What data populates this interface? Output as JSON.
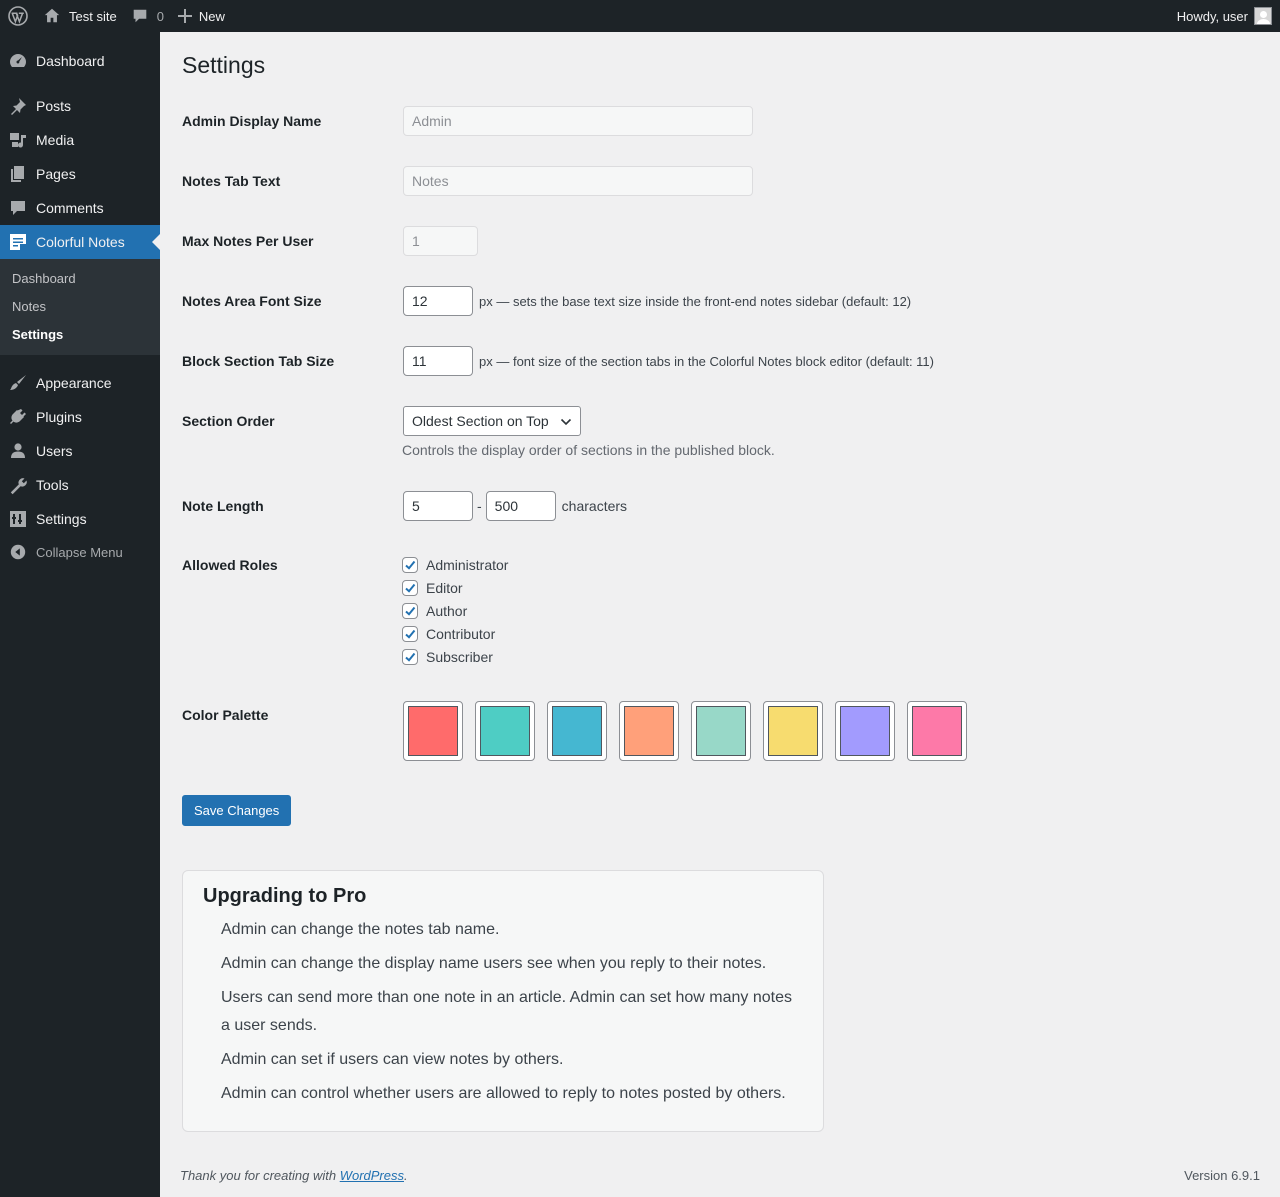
{
  "admin_bar": {
    "site_name": "Test site",
    "comments_count": "0",
    "new_label": "New",
    "greeting": "Howdy, user"
  },
  "sidebar": {
    "items": [
      {
        "label": "Dashboard",
        "icon": "dashboard-icon"
      },
      {
        "label": "Posts",
        "icon": "pin-icon"
      },
      {
        "label": "Media",
        "icon": "media-icon"
      },
      {
        "label": "Pages",
        "icon": "pages-icon"
      },
      {
        "label": "Comments",
        "icon": "comment-icon"
      },
      {
        "label": "Colorful Notes",
        "icon": "notes-icon",
        "current": true
      },
      {
        "label": "Appearance",
        "icon": "brush-icon"
      },
      {
        "label": "Plugins",
        "icon": "plugin-icon"
      },
      {
        "label": "Users",
        "icon": "user-icon"
      },
      {
        "label": "Tools",
        "icon": "wrench-icon"
      },
      {
        "label": "Settings",
        "icon": "settings-icon"
      }
    ],
    "submenu": [
      {
        "label": "Dashboard"
      },
      {
        "label": "Notes"
      },
      {
        "label": "Settings",
        "current": true
      }
    ],
    "collapse_label": "Collapse Menu"
  },
  "page": {
    "title": "Settings"
  },
  "settings": {
    "admin_display_name": {
      "label": "Admin Display Name",
      "placeholder": "Admin"
    },
    "notes_tab_text": {
      "label": "Notes Tab Text",
      "placeholder": "Notes"
    },
    "max_notes": {
      "label": "Max Notes Per User",
      "value": "1"
    },
    "font_size": {
      "label": "Notes Area Font Size",
      "value": "12",
      "description": "px — sets the base text size inside the front-end notes sidebar (default: 12)"
    },
    "tab_size": {
      "label": "Block Section Tab Size",
      "value": "11",
      "description": "px — font size of the section tabs in the Colorful Notes block editor (default: 11)"
    },
    "section_order": {
      "label": "Section Order",
      "value": "Oldest Section on Top",
      "description": "Controls the display order of sections in the published block."
    },
    "note_length": {
      "label": "Note Length",
      "min": "5",
      "separator": "-",
      "max": "500",
      "unit": "characters"
    },
    "allowed_roles": {
      "label": "Allowed Roles",
      "roles": [
        {
          "name": "Administrator",
          "checked": true
        },
        {
          "name": "Editor",
          "checked": true
        },
        {
          "name": "Author",
          "checked": true
        },
        {
          "name": "Contributor",
          "checked": true
        },
        {
          "name": "Subscriber",
          "checked": true
        }
      ]
    },
    "color_palette": {
      "label": "Color Palette",
      "colors": [
        "#ff6b6b",
        "#4ecdc4",
        "#45b7d1",
        "#ffa07a",
        "#98d8c8",
        "#f7dc6f",
        "#a29bfe",
        "#fd79a8"
      ]
    },
    "save_label": "Save Changes"
  },
  "upgrade": {
    "title": "Upgrading to Pro",
    "items": [
      "Admin can change the notes tab name.",
      "Admin can change the display name users see when you reply to their notes.",
      "Users can send more than one note in an article. Admin can set how many notes a user sends.",
      "Admin can set if users can view notes by others.",
      "Admin can control whether users are allowed to reply to notes posted by others."
    ]
  },
  "footer": {
    "thanks_prefix": "Thank you for creating with ",
    "link_text": "WordPress",
    "thanks_suffix": ".",
    "version": "Version 6.9.1"
  },
  "colors": {
    "admin_bar_bg": "#1d2327",
    "accent": "#2271b1",
    "submenu_bg": "#2c3338",
    "page_bg": "#f0f0f1"
  }
}
